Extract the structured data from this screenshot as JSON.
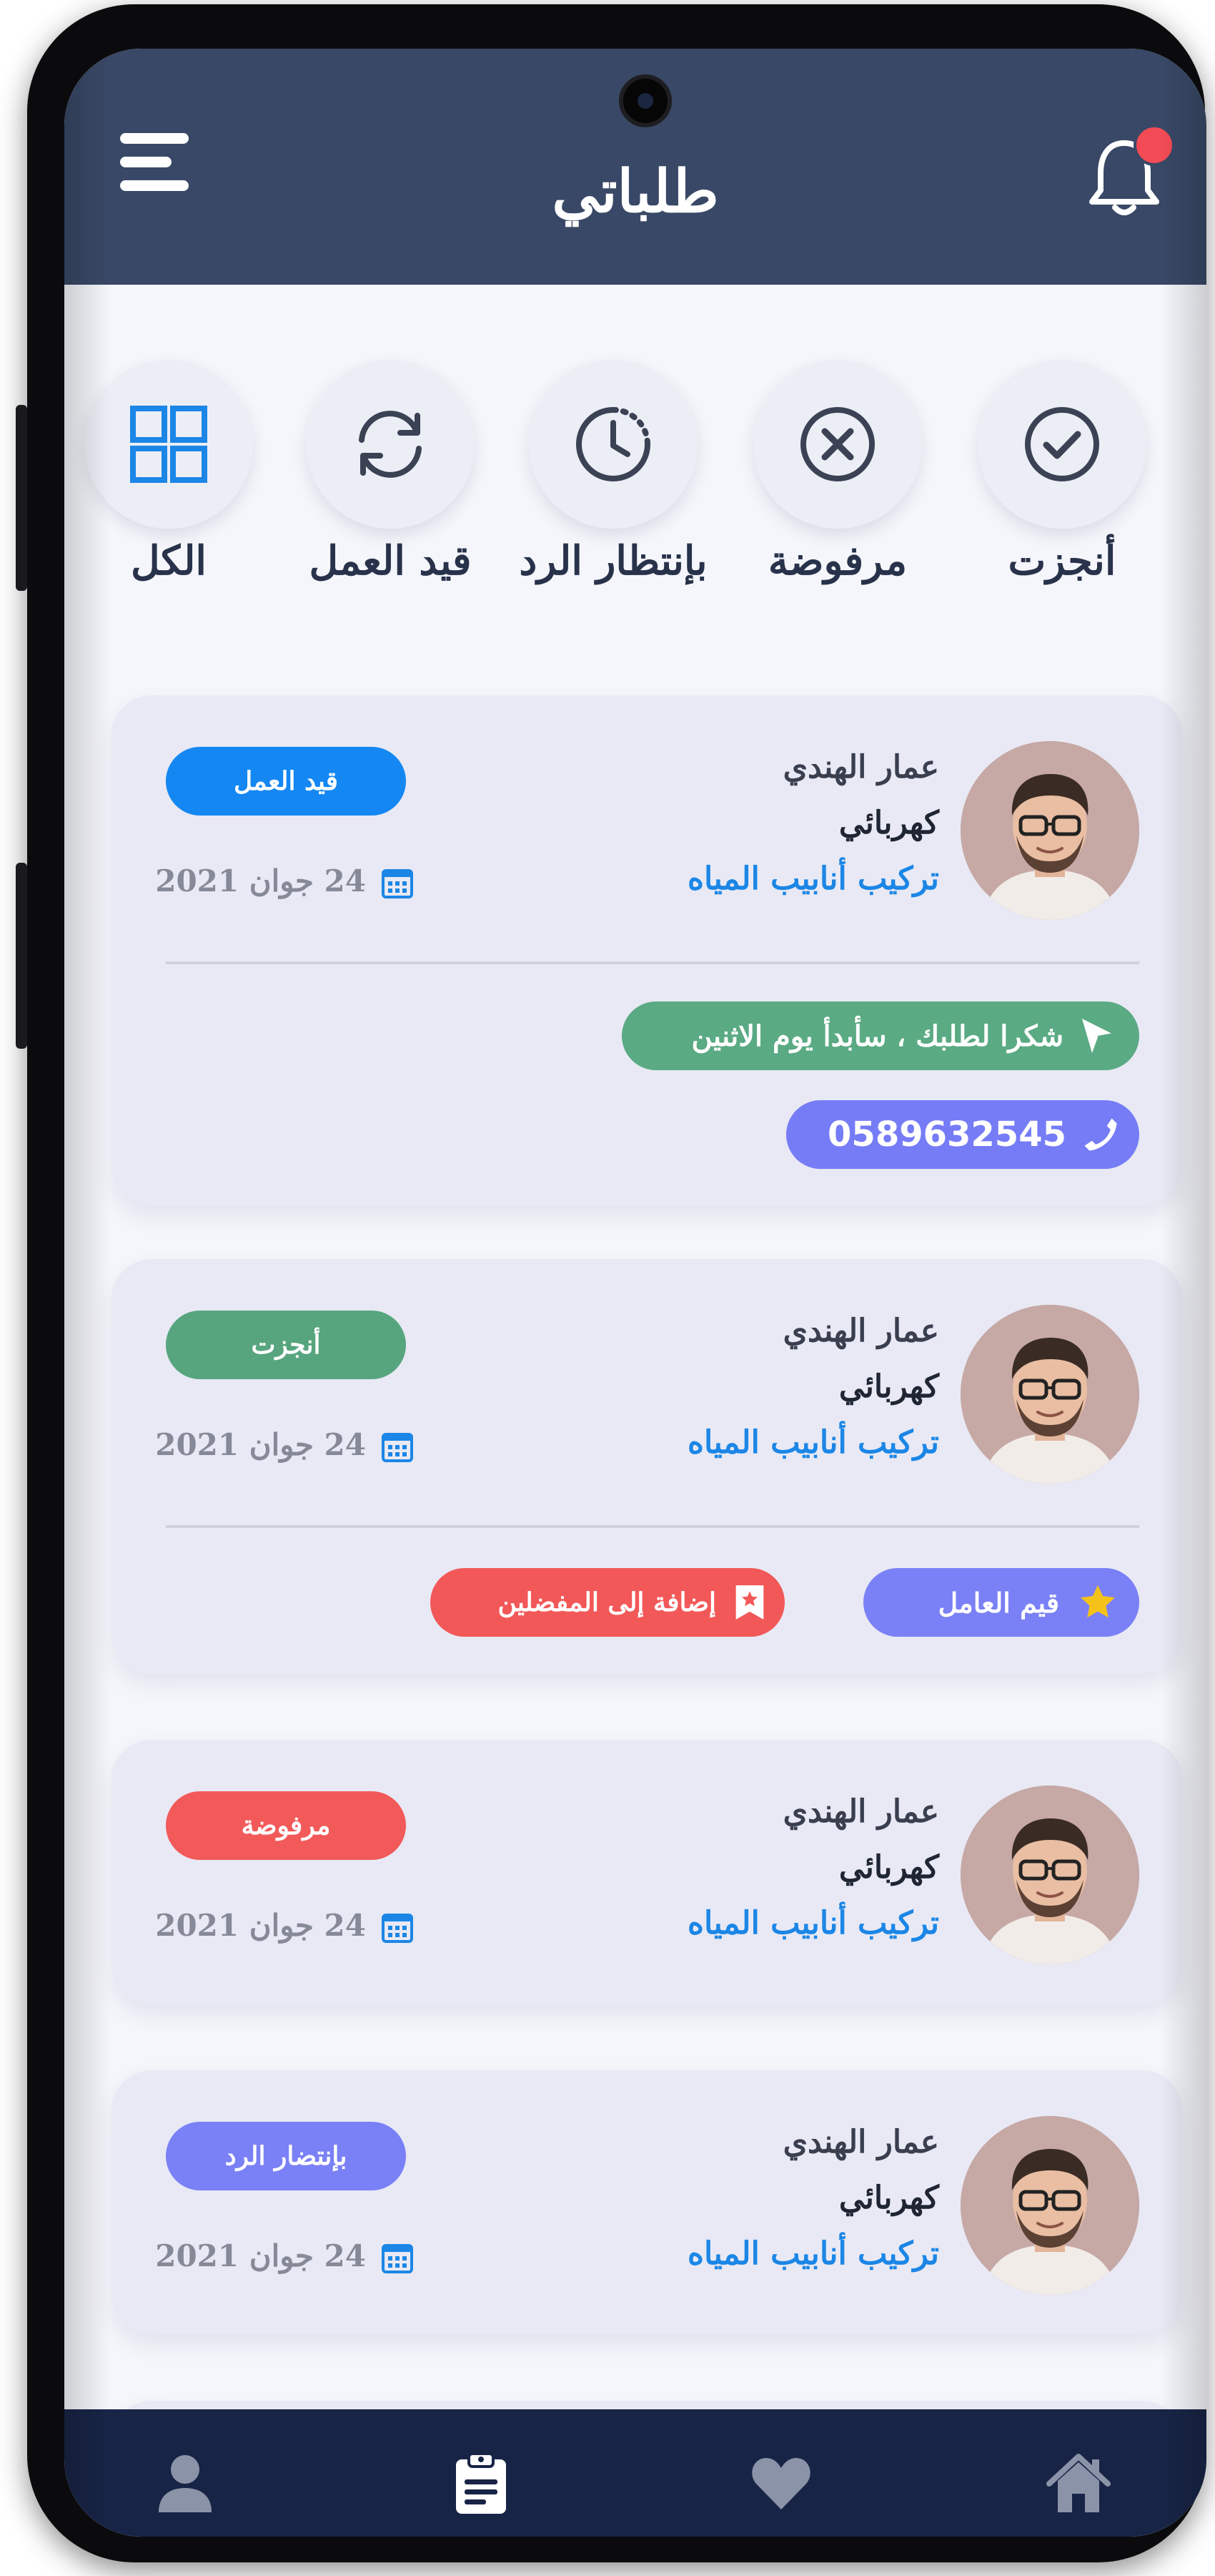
{
  "header": {
    "title": "طلباتي",
    "menu_icon": "hamburger-menu-icon",
    "bell_icon": "bell-icon",
    "has_notification": true
  },
  "filters": [
    {
      "label": "أنجزت",
      "icon": "check-circle-icon"
    },
    {
      "label": "مرفوضة",
      "icon": "x-circle-icon"
    },
    {
      "label": "بإنتظار الرد",
      "icon": "clock-icon"
    },
    {
      "label": "قيد العمل",
      "icon": "refresh-icon"
    },
    {
      "label": "الكل",
      "icon": "grid-icon"
    }
  ],
  "orders": [
    {
      "name": "عمار الهندي",
      "job": "كهربائي",
      "service": "تركيب أنابيب المياه",
      "status": "قيد العمل",
      "date": "24 جوان 2021",
      "message": "شكرا لطلبك ، سأبدأ يوم الاثنين",
      "phone": "0589632545"
    },
    {
      "name": "عمار الهندي",
      "job": "كهربائي",
      "service": "تركيب أنابيب المياه",
      "status": "أنجزت",
      "date": "24 جوان 2021",
      "rate_label": "قيم العامل",
      "favorite_label": "إضافة إلى المفضلين"
    },
    {
      "name": "عمار الهندي",
      "job": "كهربائي",
      "service": "تركيب أنابيب المياه",
      "status": "مرفوضة",
      "date": "24 جوان 2021"
    },
    {
      "name": "عمار الهندي",
      "job": "كهربائي",
      "service": "تركيب أنابيب المياه",
      "status": "بإنتضار الرد",
      "date": "24 جوان 2021"
    }
  ],
  "nav": [
    {
      "icon": "user-icon"
    },
    {
      "icon": "clipboard-icon",
      "active": true
    },
    {
      "icon": "heart-icon"
    },
    {
      "icon": "home-icon"
    }
  ],
  "colors": {
    "header": "#394866",
    "bottom_nav": "#182446",
    "in_progress": "#1487f2",
    "completed": "#56a57e",
    "rejected": "#f25a5a",
    "pending": "#7a80f5",
    "message": "#5aaa83",
    "phone": "#757cf6",
    "favorite": "#f25858",
    "accent_blue": "#1b86e6"
  }
}
